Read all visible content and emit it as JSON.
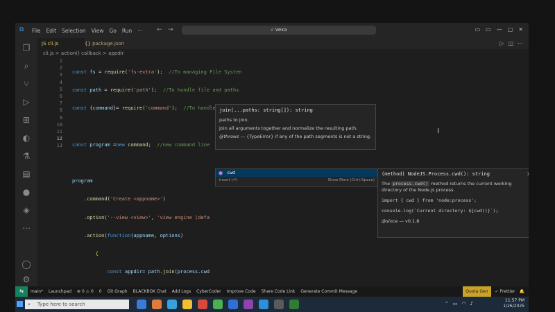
{
  "titlebar": {
    "menu": [
      "File",
      "Edit",
      "Selection",
      "View",
      "Go",
      "Run",
      "···"
    ],
    "search": "Vexa",
    "nav_back": "←",
    "nav_forward": "→"
  },
  "tabs": [
    {
      "label": "cli.js"
    },
    {
      "label": "package.json"
    }
  ],
  "breadcrumb": {
    "file": "cli.js",
    "sep1": ">",
    "scope": "action() callback",
    "sep2": ">",
    "symbol": "appdir"
  },
  "editor": {
    "line_numbers": [
      "1",
      "2",
      "3",
      "4",
      "5",
      "6",
      "7",
      "8",
      "9",
      "10",
      "11",
      "12",
      "13"
    ],
    "current_line": "12"
  },
  "hover": {
    "signature": "join(...paths: string[]): string",
    "param": "paths to join.",
    "description": "Join all arguments together and normalize the resulting path.",
    "throws_tag": "@throws",
    "throws_text": " — {TypeError} if any of the path segments is not a string."
  },
  "suggest": {
    "item": "cwd",
    "insert": "Insert (⏎)",
    "show_more": "Show More (Ctrl+Space)"
  },
  "detail": {
    "signature": "(method) NodeJS.Process.cwd(): string",
    "close": "×",
    "desc_pre": "The ",
    "desc_code": "process.cwd()",
    "desc_post": " method returns the current working directory of the Node.js process.",
    "import_line": "import { cwd } from 'node:process';",
    "log_line": "console.log(`Current directory: ${cwd()}`);",
    "since_tag": "@since",
    "since_text": " — v0.1.8"
  },
  "statusbar": {
    "branch": "main*",
    "launchpad": "Launchpad",
    "problems": "⊗ 0 ⚠ 0",
    "ports": "0",
    "gitgraph": "Git Graph",
    "blackbox": "BLACKBOX Chat",
    "addlogs": "Add Logs",
    "cybercoder": "CyberCoder",
    "improve": "Improve Code",
    "share": "Share Code Link",
    "generate": "Generate Commit Message",
    "quota": "Quota Gen",
    "prettier": "✓ Prettier"
  },
  "taskbar": {
    "search_placeholder": "Type here to search",
    "time": "11:57 PM",
    "date": "1/26/2025"
  }
}
